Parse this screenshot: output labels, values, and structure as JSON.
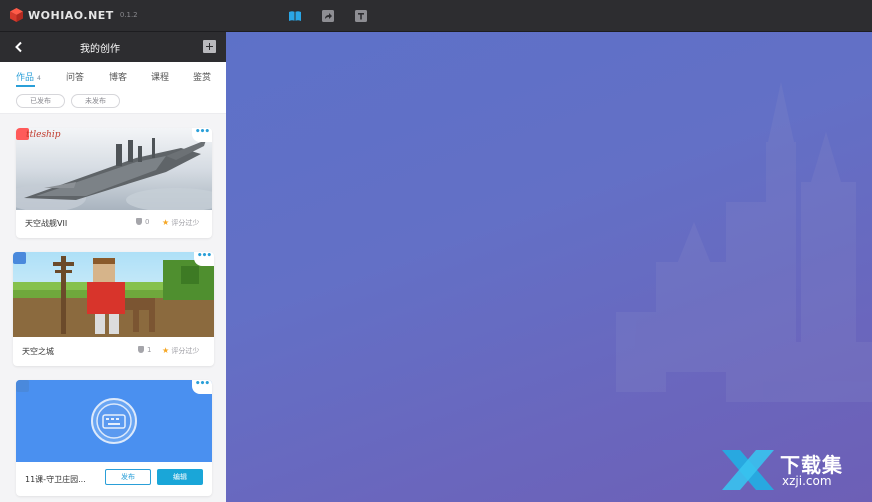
{
  "app": {
    "name": "WOHIAO.NET",
    "version": "0.1.2",
    "toolbar": [
      "book-icon",
      "share-icon",
      "text-icon"
    ]
  },
  "panel": {
    "title": "我的创作",
    "tabs": [
      {
        "label": "作品",
        "count": "4",
        "active": true
      },
      {
        "label": "问答"
      },
      {
        "label": "博客"
      },
      {
        "label": "课程"
      },
      {
        "label": "鉴赏"
      }
    ],
    "filters": [
      "已发布",
      "未发布"
    ],
    "cards": [
      {
        "title": "天空战舰VII",
        "thumb_text": "ttleship",
        "stat_count": "0",
        "rating": "评分过少"
      },
      {
        "title": "天空之城",
        "stat_count": "1",
        "rating": "评分过少"
      },
      {
        "title": "11课-守卫庄园...",
        "publish_label": "发布",
        "edit_label": "编辑"
      }
    ]
  },
  "watermark": {
    "title": "下载集",
    "url": "xzji.com"
  },
  "colors": {
    "accent": "#2a9fd8",
    "stage": "#6370c6",
    "topbar": "#2d2d30"
  }
}
